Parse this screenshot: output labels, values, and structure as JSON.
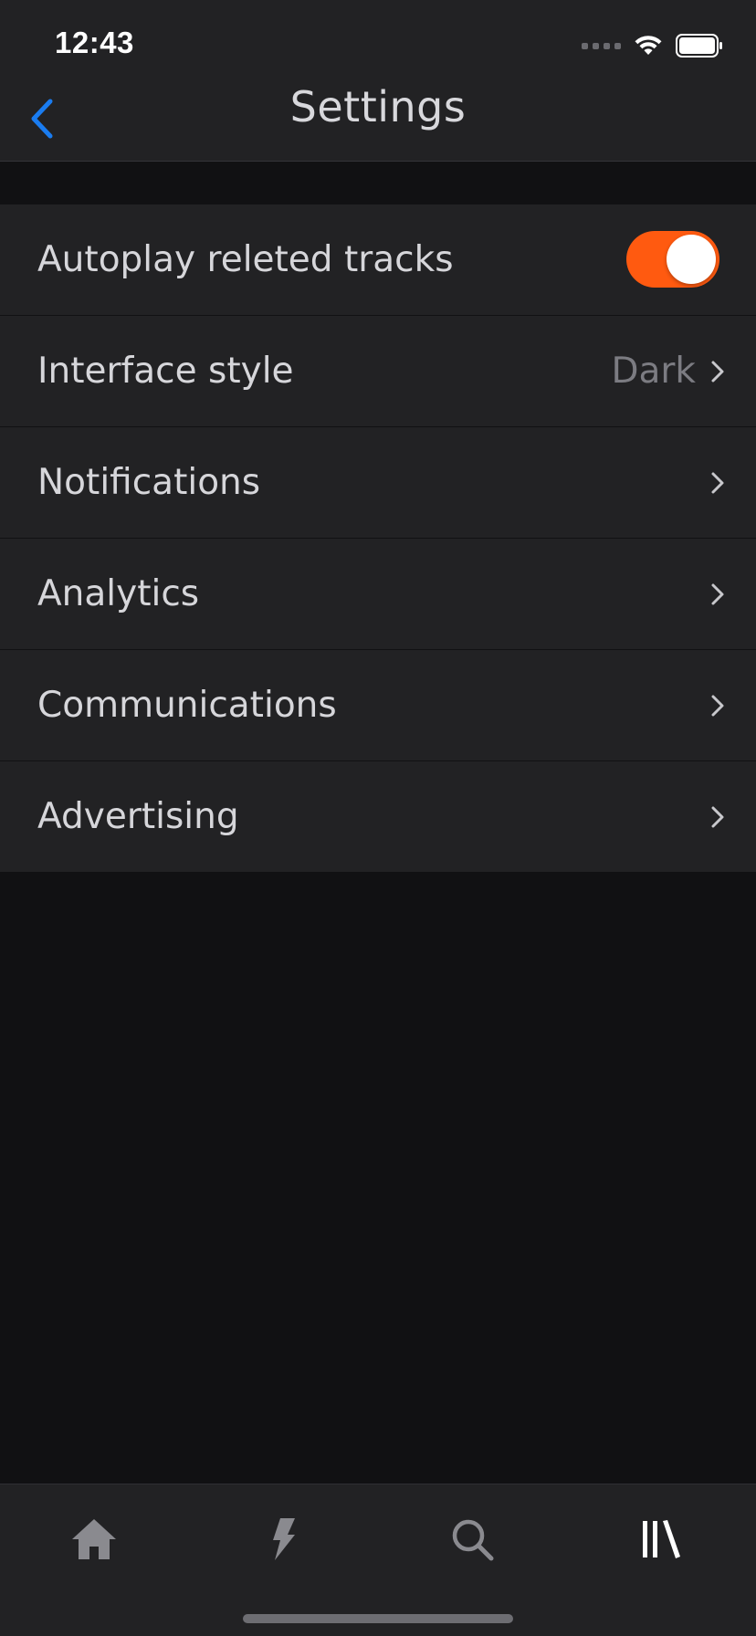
{
  "status_bar": {
    "time": "12:43",
    "icons": [
      "signal-dots-icon",
      "wifi-icon",
      "battery-icon"
    ]
  },
  "nav": {
    "title": "Settings",
    "back_icon": "chevron-left-icon"
  },
  "settings": {
    "items": [
      {
        "label": "Autoplay releted tracks",
        "control": "toggle",
        "toggle_on": true
      },
      {
        "label": "Interface style",
        "control": "disclosure",
        "value": "Dark"
      },
      {
        "label": "Notifications",
        "control": "disclosure"
      },
      {
        "label": "Analytics",
        "control": "disclosure"
      },
      {
        "label": "Communications",
        "control": "disclosure"
      },
      {
        "label": "Advertising",
        "control": "disclosure"
      }
    ]
  },
  "tab_bar": {
    "tabs": [
      {
        "icon": "home-icon",
        "selected": false
      },
      {
        "icon": "lightning-icon",
        "selected": false
      },
      {
        "icon": "search-icon",
        "selected": false
      },
      {
        "icon": "library-icon",
        "selected": true
      }
    ]
  },
  "colors": {
    "accent": "#ff5a10",
    "back_button": "#1a7cf0",
    "background": "#111113",
    "surface": "#222224",
    "text_primary": "#d6d6da",
    "text_secondary": "#7c7c82",
    "tab_inactive": "#8a8a8f",
    "tab_active": "#ffffff"
  }
}
